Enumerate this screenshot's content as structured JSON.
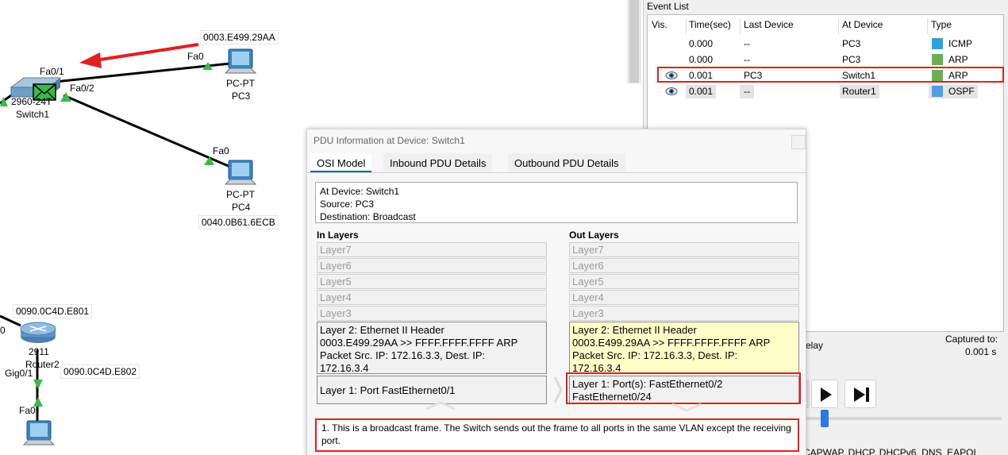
{
  "topology": {
    "switch1": {
      "model": "2960-24T",
      "name": "Switch1",
      "port_fa01": "Fa0/1",
      "port_fa02": "Fa0/2"
    },
    "pc3": {
      "type": "PC-PT",
      "name": "PC3",
      "port": "Fa0",
      "mac": "0003.E499.29AA"
    },
    "pc4": {
      "type": "PC-PT",
      "name": "PC4",
      "port": "Fa0",
      "mac": "0040.0B61.6ECB"
    },
    "router2": {
      "model": "2911",
      "name": "Router2",
      "port": "Gig0/1",
      "mac_top": "0090.0C4D.E801",
      "mac_bottom": "0090.0C4D.E802",
      "left_label": "0"
    },
    "bottom_pc": {
      "port": "Fa0",
      "type": "PC-PT"
    }
  },
  "event_list": {
    "title": "Event List",
    "columns": [
      "Vis.",
      "Time(sec)",
      "Last Device",
      "At Device",
      "Type"
    ],
    "rows": [
      {
        "time": "0.000",
        "last": "--",
        "at": "PC3",
        "type": "ICMP",
        "color": "#2aa3e0",
        "eye": false,
        "highlight": false
      },
      {
        "time": "0.000",
        "last": "--",
        "at": "PC3",
        "type": "ARP",
        "color": "#6ab04c",
        "eye": false,
        "highlight": false
      },
      {
        "time": "0.001",
        "last": "PC3",
        "at": "Switch1",
        "type": "ARP",
        "color": "#6ab04c",
        "eye": true,
        "highlight": true
      },
      {
        "time": "0.001",
        "last": "--",
        "at": "Router1",
        "type": "OSPF",
        "color": "#4b9fe8",
        "eye": true,
        "highlight": false
      }
    ],
    "captured_label": "Captured to:",
    "captured_value": "0.001 s",
    "delay_fragment": "elay",
    "filters_fragment": "CAPWAP, DHCP, DHCPv6, DNS, EAPOL"
  },
  "pdu": {
    "title": "PDU Information at Device: Switch1",
    "tabs": [
      "OSI Model",
      "Inbound PDU Details",
      "Outbound PDU Details"
    ],
    "device_lines": [
      "At Device: Switch1",
      "Source: PC3",
      "Destination: Broadcast"
    ],
    "in_title": "In Layers",
    "out_title": "Out Layers",
    "upper_layers": [
      "Layer7",
      "Layer6",
      "Layer5",
      "Layer4",
      "Layer3"
    ],
    "layer2_lines": [
      "Layer 2: Ethernet II Header",
      "0003.E499.29AA >> FFFF.FFFF.FFFF ARP",
      "Packet Src. IP: 172.16.3.3, Dest. IP:",
      "172.16.3.4"
    ],
    "in_layer1": "Layer 1: Port FastEthernet0/1",
    "out_layer1_lines": [
      "Layer 1: Port(s): FastEthernet0/2",
      "FastEthernet0/24"
    ],
    "explanation": "1. This is a broadcast frame. The Switch sends out the frame to all ports in the same VLAN except the receiving port."
  },
  "colors": {
    "highlight_red": "#e02020",
    "out_layer2_bg": "#ffffc8",
    "link_green": "#3cb84a"
  }
}
